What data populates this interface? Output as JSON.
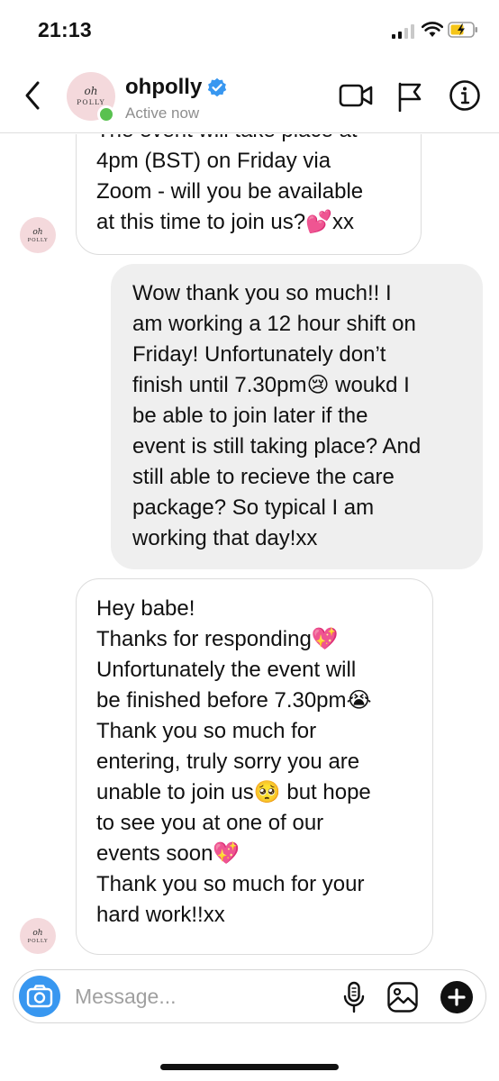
{
  "status_bar": {
    "time": "21:13"
  },
  "header": {
    "username": "ohpolly",
    "status": "Active now",
    "avatar_logo_text": "oh POLLY",
    "verified": true
  },
  "messages": [
    {
      "sender": "ohpolly",
      "direction": "incoming",
      "lines": [
        "The event will take place at",
        "4pm (BST) on Friday via",
        "Zoom - will you be available",
        "at this time to join us?💕xx"
      ]
    },
    {
      "sender": "me",
      "direction": "outgoing",
      "lines": [
        "Wow thank you so much!! I",
        "am working a 12 hour shift on",
        "Friday! Unfortunately don’t",
        "finish until 7.30pm😢 woukd I",
        "be able to join later if the",
        "event is still taking place? And",
        "still able to recieve the care",
        "package? So typical I am",
        "working that day!xx"
      ]
    },
    {
      "sender": "ohpolly",
      "direction": "incoming",
      "lines": [
        "Hey babe!",
        "Thanks for responding💖",
        "Unfortunately the event will",
        "be finished before 7.30pm😭",
        "Thank you so much for",
        "entering, truly sorry you are",
        "unable to join us🥺 but hope",
        "to see you at one of our",
        "events soon💖",
        "Thank you so much for your",
        "hard work!!xx"
      ]
    }
  ],
  "composer": {
    "placeholder": "Message...",
    "value": ""
  },
  "icons": {
    "back": "chevron-left-icon",
    "video": "video-camera-icon",
    "flag": "flag-icon",
    "info": "info-icon",
    "camera": "camera-icon",
    "mic": "microphone-icon",
    "gallery": "gallery-icon",
    "plus": "plus-icon"
  },
  "colors": {
    "online": "#59c14f",
    "camera_button": "#3897f0",
    "verified_badge": "#3897f0",
    "outgoing_bubble": "#efefef",
    "avatar_bg": "#f4d9dc"
  }
}
